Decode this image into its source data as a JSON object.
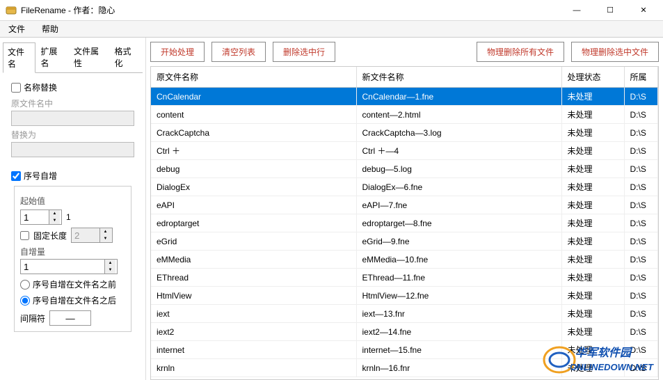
{
  "title": "FileRename - 作者：隐心",
  "menubar": {
    "file": "文件",
    "help": "帮助"
  },
  "tabs": {
    "filename": "文件名",
    "ext": "扩展名",
    "attr": "文件属性",
    "format": "格式化"
  },
  "replace": {
    "chk_label": "名称替换",
    "original_label": "原文件名中",
    "original_value": "",
    "replace_label": "替换为",
    "replace_value": ""
  },
  "seq": {
    "chk_label": "序号自增",
    "start_label": "起始值",
    "start_value": "1",
    "start_display": "1",
    "fixed_chk_label": "固定长度",
    "fixed_value": "2",
    "inc_label": "自增量",
    "inc_value": "1",
    "radio_before": "序号自增在文件名之前",
    "radio_after": "序号自增在文件名之后",
    "sep_label": "间隔符",
    "sep_value": "—"
  },
  "buttons": {
    "start": "开始处理",
    "clear": "清空列表",
    "del_sel": "删除选中行",
    "del_all_phys": "物理删除所有文件",
    "del_sel_phys": "物理删除选中文件"
  },
  "columns": {
    "orig": "原文件名称",
    "new": "新文件名称",
    "status": "处理状态",
    "path": "所属"
  },
  "status_text": "未处理",
  "path_text": "D:\\S",
  "rows": [
    {
      "orig": "CnCalendar",
      "new": "CnCalendar—1.fne",
      "sel": true
    },
    {
      "orig": "content",
      "new": "content—2.html"
    },
    {
      "orig": "CrackCaptcha",
      "new": "CrackCaptcha—3.log"
    },
    {
      "orig": "Ctrl ＋",
      "new": "Ctrl ＋—4"
    },
    {
      "orig": "debug",
      "new": "debug—5.log"
    },
    {
      "orig": "DialogEx",
      "new": "DialogEx—6.fne"
    },
    {
      "orig": "eAPI",
      "new": "eAPI—7.fne"
    },
    {
      "orig": "edroptarget",
      "new": "edroptarget—8.fne"
    },
    {
      "orig": "eGrid",
      "new": "eGrid—9.fne"
    },
    {
      "orig": "eMMedia",
      "new": "eMMedia—10.fne"
    },
    {
      "orig": "EThread",
      "new": "EThread—11.fne"
    },
    {
      "orig": "HtmlView",
      "new": "HtmlView—12.fne"
    },
    {
      "orig": "iext",
      "new": "iext—13.fnr"
    },
    {
      "orig": "iext2",
      "new": "iext2—14.fne"
    },
    {
      "orig": "internet",
      "new": "internet—15.fne"
    },
    {
      "orig": "krnln",
      "new": "krnln—16.fnr"
    }
  ],
  "watermark": {
    "line1": "华军软件园",
    "line2": "ONLINEDOWN.NET"
  }
}
